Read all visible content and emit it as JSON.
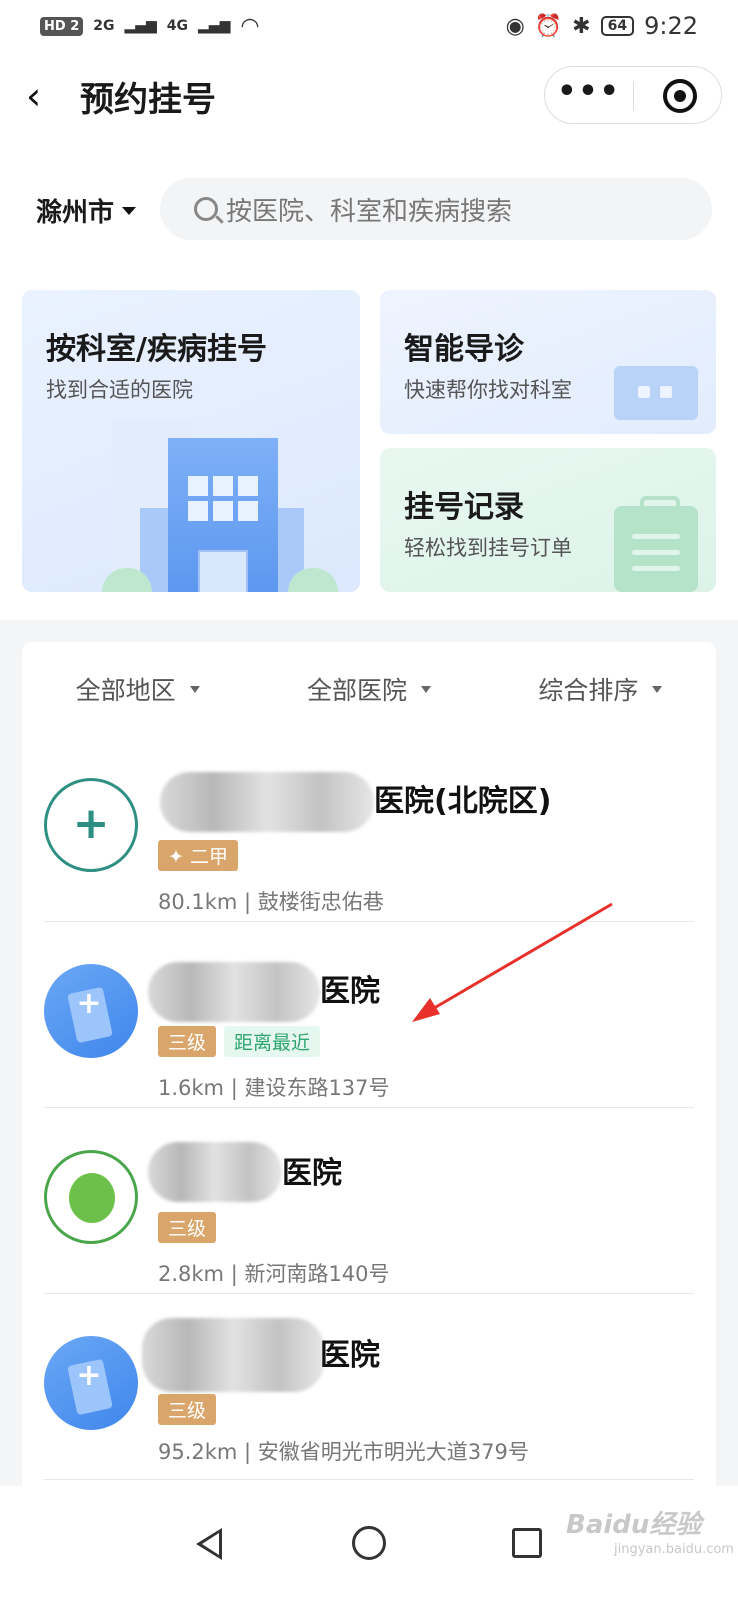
{
  "status_bar": {
    "hd": "HD",
    "sim": "2",
    "signal_1": "2G",
    "signal_2": "4G",
    "battery": "64",
    "time": "9:22"
  },
  "header": {
    "title": "预约挂号",
    "menu_dots": "•••"
  },
  "search": {
    "city": "滁州市",
    "placeholder": "按医院、科室和疾病搜索"
  },
  "cards": {
    "dept": {
      "title": "按科室/疾病挂号",
      "subtitle": "找到合适的医院"
    },
    "guide": {
      "title": "智能导诊",
      "subtitle": "快速帮你找对科室"
    },
    "record": {
      "title": "挂号记录",
      "subtitle": "轻松找到挂号订单"
    }
  },
  "filters": [
    {
      "label": "全部地区"
    },
    {
      "label": "全部医院"
    },
    {
      "label": "综合排序"
    }
  ],
  "hospitals": [
    {
      "name_visible": "医院(北院区)",
      "level": "二甲",
      "near_tag": "",
      "distance": "80.1km | 鼓楼街忠佑巷"
    },
    {
      "name_visible": "医院",
      "level": "三级",
      "near_tag": "距离最近",
      "distance": "1.6km | 建设东路137号"
    },
    {
      "name_visible": "医院",
      "level": "三级",
      "near_tag": "",
      "distance": "2.8km | 新河南路140号"
    },
    {
      "name_visible": "医院",
      "level": "三级",
      "near_tag": "",
      "distance": "95.2km | 安徽省明光市明光大道379号"
    }
  ],
  "watermark": {
    "text": "Baidu经验",
    "sub": "jingyan.baidu.com"
  },
  "colors": {
    "level_tag": "#d9a56a",
    "near_tag": "#2fa56f",
    "annotation_arrow": "#e8312a"
  }
}
